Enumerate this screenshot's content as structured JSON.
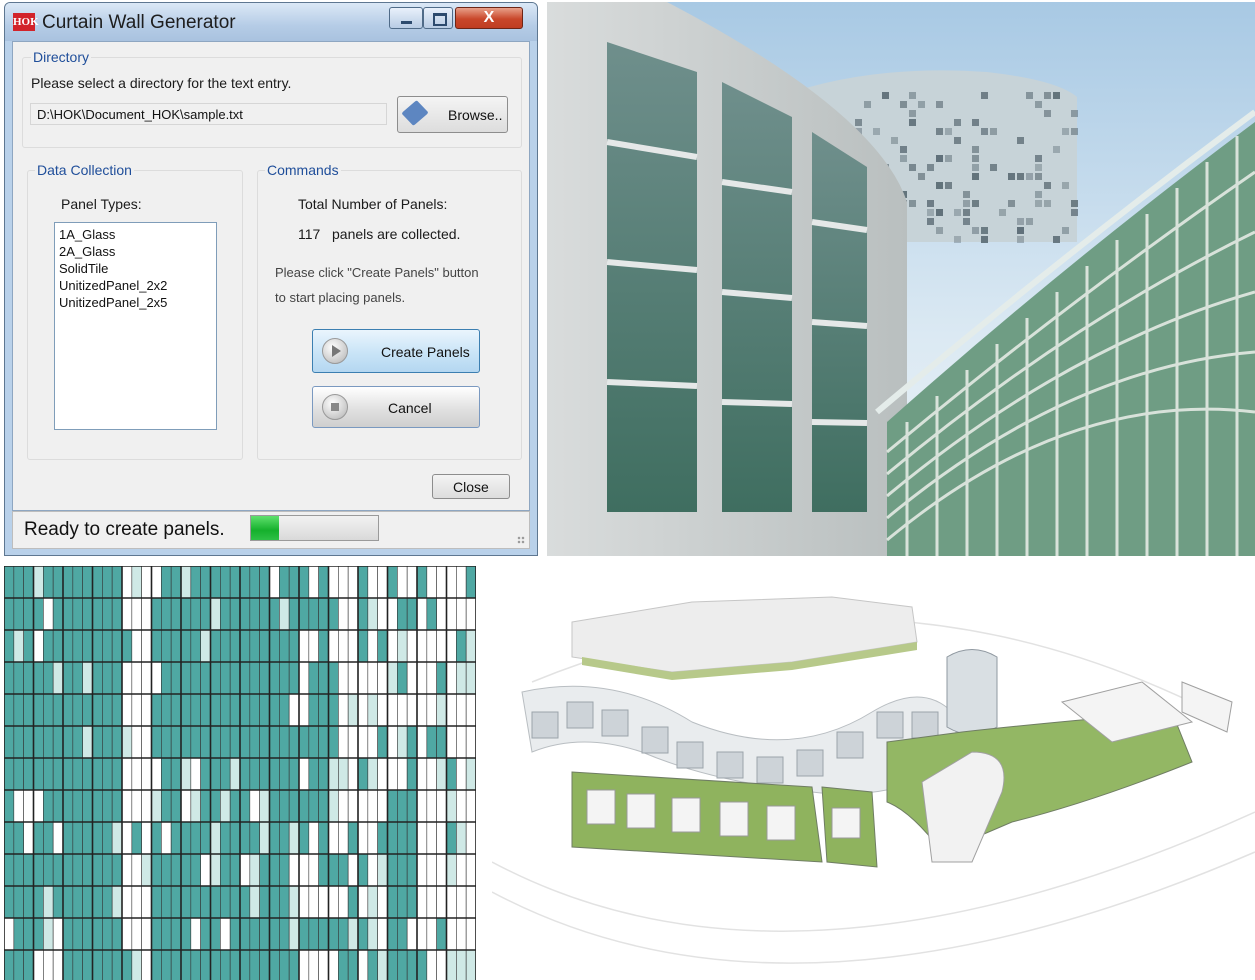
{
  "window": {
    "title": "Curtain Wall Generator",
    "app_icon_text": "HOK",
    "close_glyph": "X"
  },
  "directory": {
    "group_title": "Directory",
    "prompt": "Please select a directory for the text entry.",
    "path_value": "D:\\HOK\\Document_HOK\\sample.txt",
    "browse_label": "Browse..",
    "browse_icon": "pencil-icon"
  },
  "data_collection": {
    "group_title": "Data Collection",
    "panel_types_label": "Panel Types:",
    "panel_types": [
      "1A_Glass",
      "2A_Glass",
      "SolidTile",
      "UnitizedPanel_2x2",
      "UnitizedPanel_2x5"
    ]
  },
  "commands": {
    "group_title": "Commands",
    "total_label": "Total Number of Panels:",
    "count": "117",
    "count_suffix": "panels are collected.",
    "instruction_line1": "Please click \"Create Panels\" button",
    "instruction_line2": "to start placing panels.",
    "create_label": "Create Panels",
    "cancel_label": "Cancel",
    "create_icon": "play-icon",
    "cancel_icon": "stop-icon"
  },
  "footer": {
    "close_label": "Close"
  },
  "status": {
    "text": "Ready to create panels.",
    "progress": 0.22
  },
  "colors": {
    "accent": "#1f4e9a",
    "panel_teal": "#4fa8a3",
    "panel_light": "#cfe9e6",
    "progress_green": "#15b02c",
    "close_red": "#c9472b"
  }
}
